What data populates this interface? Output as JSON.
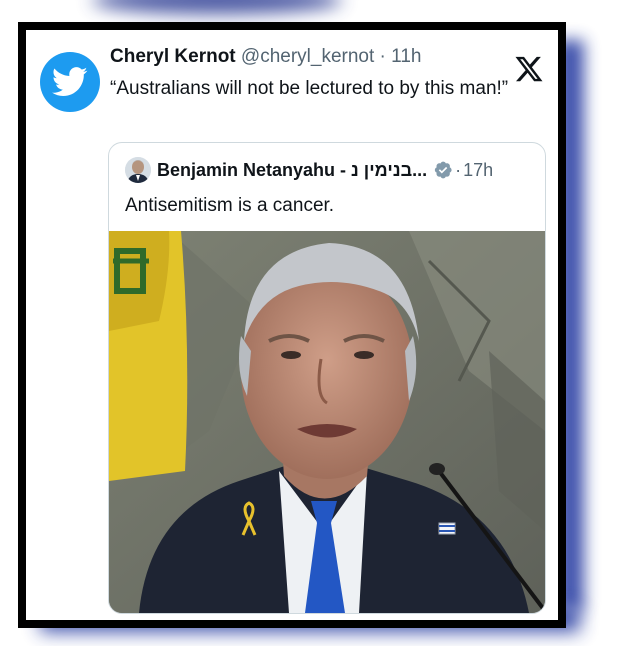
{
  "tweet": {
    "author_name": "Cheryl Kernot",
    "author_handle": "@cheryl_kernot",
    "separator": " · ",
    "time": "11h",
    "text": "“Australians will not be lectured to by this man!”"
  },
  "quoted_tweet": {
    "author_name": "Benjamin Netanyahu - בנימין נ...",
    "time": "17h",
    "separator": " · ",
    "text": "Antisemitism is a cancer.",
    "verified": true
  },
  "icons": {
    "twitter_bird": "twitter-bird-icon",
    "x_logo": "x-logo-icon",
    "verified": "verified-badge-icon"
  },
  "colors": {
    "twitter_blue": "#1d9bf0",
    "frame_shadow": "#2a3fa3",
    "text_primary": "#0f1419",
    "text_secondary": "#536471"
  }
}
